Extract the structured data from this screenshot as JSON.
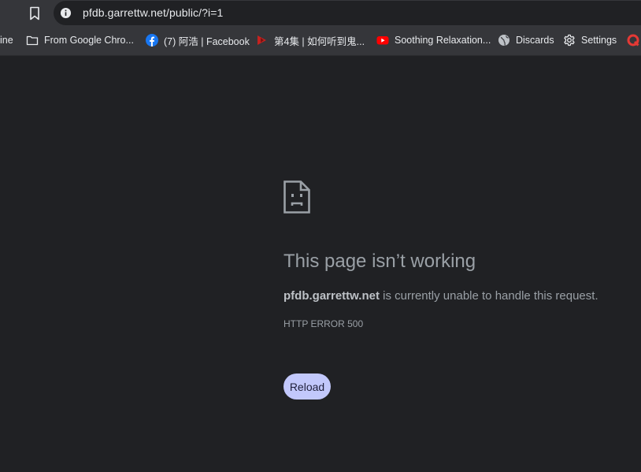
{
  "browser": {
    "url": "pfdb.garrettw.net/public/?i=1"
  },
  "bookmarks": {
    "items": [
      {
        "label": "ine",
        "icon": "none"
      },
      {
        "label": "From Google Chro...",
        "icon": "folder-icon"
      },
      {
        "label": "(7) 阿浩 | Facebook",
        "icon": "facebook-icon"
      },
      {
        "label": "第4集 | 如何听到鬼...",
        "icon": "media-icon"
      },
      {
        "label": "Soothing Relaxation...",
        "icon": "youtube-icon"
      },
      {
        "label": "Discards",
        "icon": "globe-icon"
      },
      {
        "label": "Settings",
        "icon": "gear-icon"
      }
    ]
  },
  "error": {
    "title": "This page isn’t working",
    "host": "pfdb.garrettw.net",
    "message": " is currently unable to handle this request.",
    "code": "HTTP ERROR 500",
    "reload_label": "Reload"
  },
  "colors": {
    "page_bg": "#202124",
    "chrome_bg": "#35363a",
    "reload_button": "#c2c8fb",
    "text_muted": "#9aa0a6"
  }
}
